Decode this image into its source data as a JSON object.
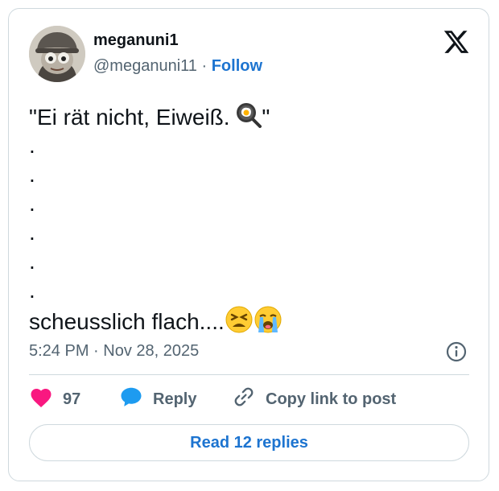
{
  "author": {
    "display_name": "meganuni1",
    "handle": "@meganuni11",
    "separator": "·",
    "follow_label": "Follow"
  },
  "tweet": {
    "line1": "\"Ei rät nicht, Eiweiß. ",
    "line1_end": "\"",
    "dots": [
      ".",
      ".",
      ".",
      ".",
      ".",
      "."
    ],
    "last_line": "scheusslich flach....",
    "emojis": [
      "fried-egg-in-pan",
      "tired-face",
      "loudly-crying-face"
    ]
  },
  "meta": {
    "time": "5:24 PM",
    "separator": "·",
    "date": "Nov 28, 2025"
  },
  "actions": {
    "like_count": "97",
    "reply_label": "Reply",
    "copy_label": "Copy link to post"
  },
  "read_replies_label": "Read 12 replies",
  "colors": {
    "accent": "#1d74d0",
    "heart": "#f91880",
    "reply_bubble": "#1d9bf0",
    "muted": "#536471",
    "border": "#cfd9de"
  },
  "icons": [
    "x-logo-icon",
    "info-icon",
    "heart-icon",
    "reply-bubble-icon",
    "link-icon"
  ]
}
